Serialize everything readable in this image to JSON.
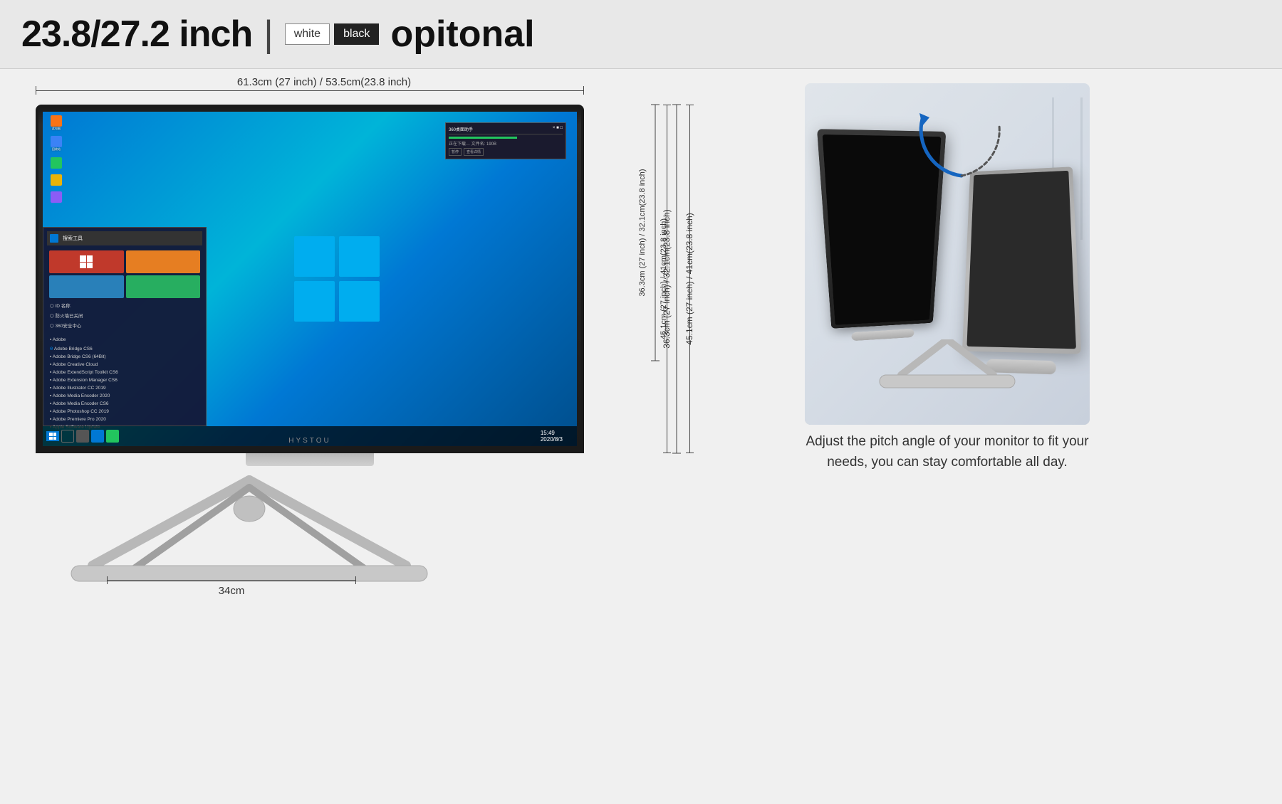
{
  "header": {
    "title": "23.8/27.2 inch",
    "divider": "|",
    "color_white_label": "white",
    "color_black_label": "black",
    "optional_label": "opitonal"
  },
  "dimensions": {
    "width_label": "61.3cm (27 inch) / 53.5cm(23.8 inch)",
    "height_label_1": "45.1cm (27 inch) / 41cm(23.8 inch)",
    "height_label_2": "36.3cm (27 inch) / 32.1cm(23.8 inch)",
    "base_width_label": "34cm"
  },
  "monitor": {
    "brand": "HYSTOU"
  },
  "right_section": {
    "description": "Adjust the pitch angle of your monitor to fit your needs, you can stay comfortable all day."
  }
}
